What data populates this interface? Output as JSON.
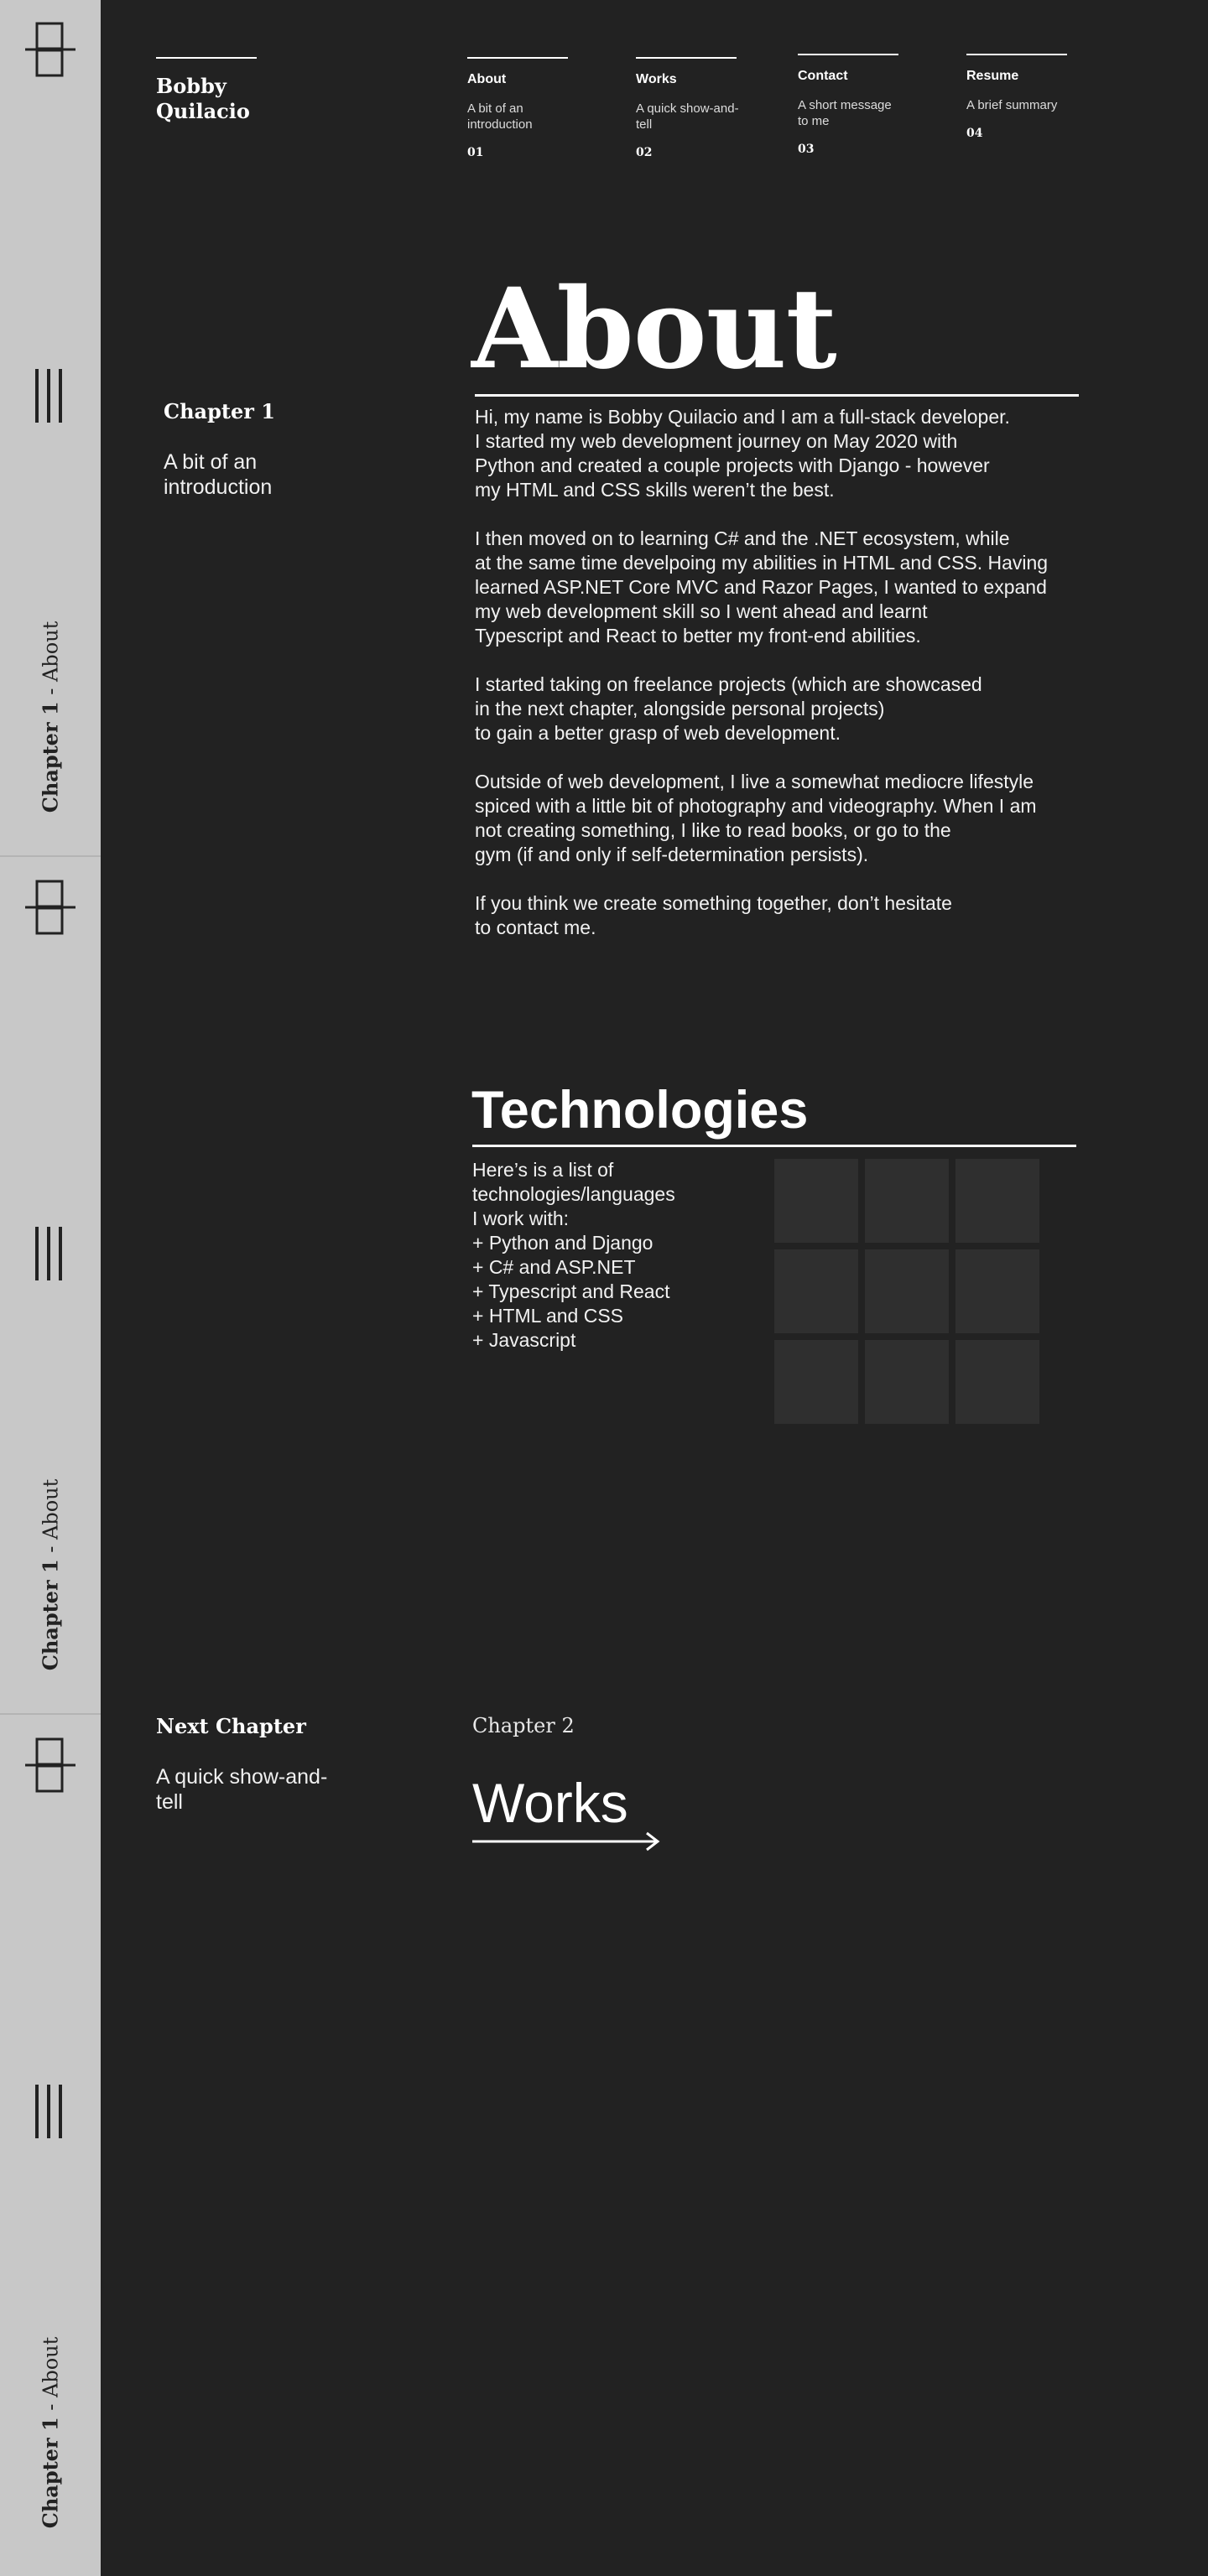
{
  "rail": {
    "chapter_label_bold": "Chapter 1",
    "chapter_label_rest": " - About",
    "logo_icon": "stacked-squares-icon",
    "menu_icon": "vertical-bars-icon"
  },
  "brand": {
    "name": "Bobby Quilacio"
  },
  "nav": [
    {
      "title": "About",
      "desc": "A bit of an introduction",
      "num": "01"
    },
    {
      "title": "Works",
      "desc": "A quick show-and-tell",
      "num": "02"
    },
    {
      "title": "Contact",
      "desc": "A short message to me",
      "num": "03"
    },
    {
      "title": "Resume",
      "desc": "A brief summary",
      "num": "04"
    }
  ],
  "about": {
    "title": "About",
    "chapter": "Chapter 1",
    "subtitle": "A bit of an introduction",
    "paragraphs": [
      "Hi, my name is Bobby Quilacio and I am a full-stack developer.\nI started my web development journey on May 2020 with\nPython and  created a couple projects with Django - however\nmy HTML and CSS skills weren’t the best.",
      "I then moved on to learning C# and the .NET ecosystem, while\nat the same time develpoing my abilities in HTML and CSS. Having\nlearned ASP.NET Core MVC and Razor Pages, I wanted to expand\nmy web development skill so I went ahead and learnt\nTypescript and React to better my front-end abilities.",
      "I started taking on freelance projects (which are showcased\nin the next chapter, alongside personal projects)\nto gain a better grasp of web development.",
      "Outside of web development, I live a somewhat mediocre lifestyle\nspiced with a little bit of photography and videography. When I am\nnot creating something, I like to read books, or go to the\ngym (if and only if self-determination persists).",
      "If you think we create something together, don’t hesitate\nto contact me."
    ]
  },
  "technologies": {
    "title": "Technologies",
    "intro": "Here’s is a list of\ntechnologies/languages\nI work with:",
    "items": [
      "+ Python and Django",
      "+ C# and ASP.NET",
      "+ Typescript and React",
      "+ HTML and CSS",
      "+ Javascript"
    ]
  },
  "next": {
    "heading": "Next Chapter",
    "subtitle": "A quick show-and-tell",
    "chapter": "Chapter 2",
    "link": "Works",
    "arrow_icon": "arrow-right-icon"
  },
  "colors": {
    "background": "#222222",
    "rail": "#c8c8c8",
    "text": "#ffffff",
    "tile": "#2f2f2f"
  }
}
